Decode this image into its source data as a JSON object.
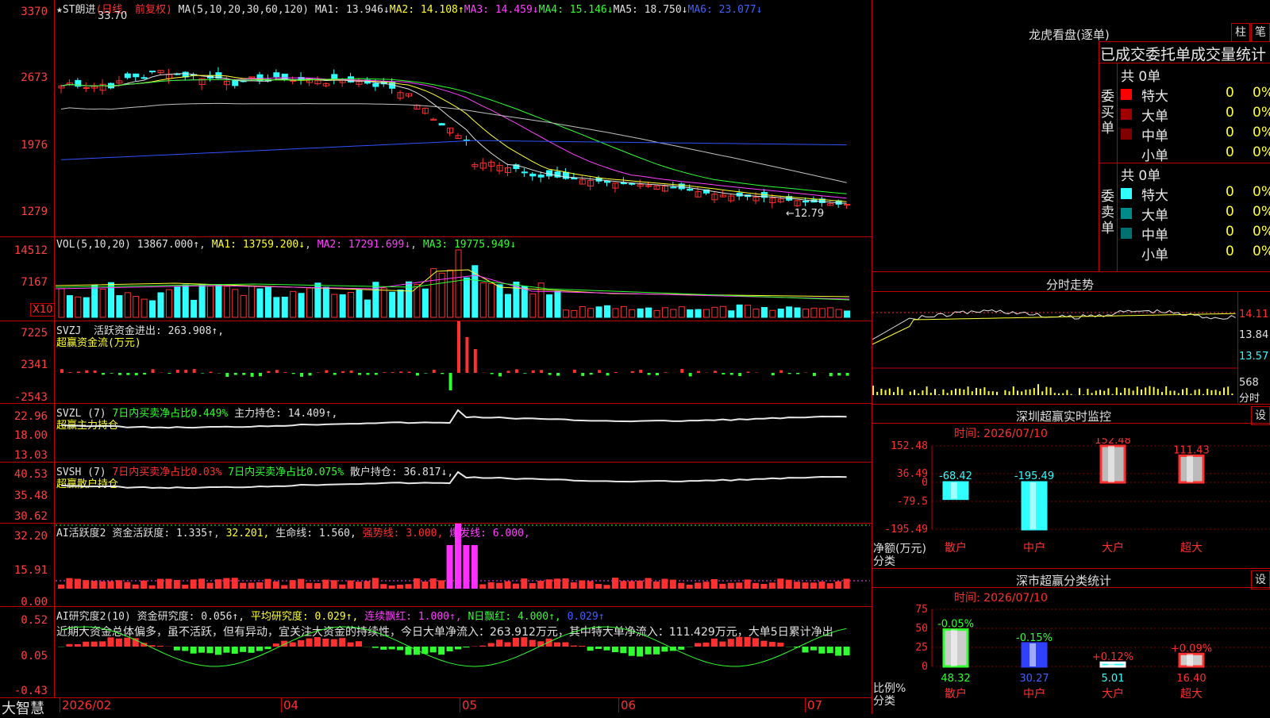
{
  "brand": "大智慧",
  "stock": {
    "title": "★ST朗进",
    "mode": "(日线, 前复权)"
  },
  "main": {
    "ma_params": "MA(5,10,20,30,60,120)",
    "ma": [
      {
        "name": "MA1",
        "value": "13.946↓",
        "color": "#e0e0e0"
      },
      {
        "name": "MA2",
        "value": "14.108↑",
        "color": "#ffff30"
      },
      {
        "name": "MA3",
        "value": "14.459↓",
        "color": "#ff40ff"
      },
      {
        "name": "MA4",
        "value": "15.146↓",
        "color": "#30ff30"
      },
      {
        "name": "MA5",
        "value": "18.750↓",
        "color": "#d0d0d0"
      },
      {
        "name": "MA6",
        "value": "23.077↓",
        "color": "#3050ff"
      }
    ],
    "yticks": [
      "3370",
      "2673",
      "1976",
      "1279"
    ],
    "high_label": "33.70",
    "low_label": "←12.79"
  },
  "vol": {
    "title": "VOL(5,10,20)",
    "value": "13867.000↑",
    "ma1": "MA1: 13759.200↓",
    "ma2": "MA2: 17291.699↓",
    "ma3": "MA3: 19775.949↓",
    "yticks": [
      "14512",
      "7167"
    ],
    "unit": "X10"
  },
  "svzj": {
    "title": "SVZJ",
    "text": "活跃资金进出: 263.908↑,",
    "sub": "超赢资金流(万元)",
    "yticks": [
      "7225",
      "2341",
      "-2543"
    ]
  },
  "svzl": {
    "title": "SVZL (7)",
    "t1": "7日内买卖净占比0.449%",
    "t2": "主力持仓: 14.409↑,",
    "sub": "超赢主力持仓",
    "yticks": [
      "22.96",
      "18.00",
      "13.03"
    ]
  },
  "svsh": {
    "title": "SVSH (7)",
    "t1": "7日内买卖净占比0.03%",
    "t2": "7日内买卖净占比0.075%",
    "t3": "散户持仓: 36.817↓,",
    "sub": "超赢散户持仓",
    "yticks": [
      "40.53",
      "35.48",
      "30.62"
    ]
  },
  "ai1": {
    "title": "AI活跃度2",
    "t1": "资金活跃度: 1.335↑",
    "t2": "32.201,",
    "t3": "生命线: 1.560,",
    "t4": "强势线: 3.000,",
    "t5": "爆发线: 6.000,",
    "yticks": [
      "32.20",
      "15.91",
      "0.00"
    ]
  },
  "ai2": {
    "title": "AI研究度2(10)",
    "t1": "资金研究度: 0.056↑,",
    "t2": "平均研究度: 0.029↑,",
    "t3": "连续飘红: 1.000↑,",
    "t4": "N日飘红: 4.000↑,",
    "t5": "0.029↑",
    "comment": "近期大资金总体偏多，虽不活跃，但有异动，宜关注大资金的持续性，今日大单净流入：263.912万元，其中特大单净流入：111.429万元，大单5日累计净出",
    "yticks": [
      "0.52",
      "0.05",
      "-0.43"
    ]
  },
  "xaxis": [
    "2026/02",
    "04",
    "05",
    "06",
    "07"
  ],
  "lhb": {
    "title": "龙虎看盘(逐单)",
    "btn1": "柱",
    "btn2": "笔",
    "header": "已成交委托单成交量统计",
    "buy": {
      "label": "委买单",
      "total": "共 0单",
      "rows": [
        {
          "name": "特大",
          "v": "0",
          "p": "0%"
        },
        {
          "name": "大单",
          "v": "0",
          "p": "0%"
        },
        {
          "name": "中单",
          "v": "0",
          "p": "0%"
        },
        {
          "name": "小单",
          "v": "0",
          "p": "0%"
        }
      ]
    },
    "sell": {
      "label": "委卖单",
      "total": "共 0单",
      "rows": [
        {
          "name": "特大",
          "v": "0",
          "p": "0%"
        },
        {
          "name": "大单",
          "v": "0",
          "p": "0%"
        },
        {
          "name": "中单",
          "v": "0",
          "p": "0%"
        },
        {
          "name": "小单",
          "v": "0",
          "p": "0%"
        }
      ]
    }
  },
  "fs": {
    "title": "分时走势",
    "yticks": [
      "14.11",
      "13.84",
      "13.57"
    ],
    "vol": "568",
    "vol_unit": "分时"
  },
  "sz_monitor": {
    "title": "深圳超赢实时监控",
    "btn": "设",
    "time": "时间: 2026/07/10",
    "ylabel1": "净额(万元)",
    "ylabel2": "分类"
  },
  "sz_stat": {
    "title": "深市超赢分类统计",
    "btn": "设",
    "time": "时间: 2026/07/10",
    "ylabel1": "比例%",
    "ylabel2": "分类"
  },
  "chart_data": [
    {
      "type": "bar",
      "title": "深圳超赢实时监控",
      "categories": [
        "散户",
        "中户",
        "大户",
        "超大"
      ],
      "values": [
        -68.42,
        -195.49,
        152.48,
        111.43
      ],
      "ylabel": "净额(万元)",
      "yticks": [
        152.48,
        36.49,
        0,
        -79.5,
        -195.49
      ],
      "ylim": [
        -195.49,
        152.48
      ]
    },
    {
      "type": "bar",
      "title": "深市超赢分类统计",
      "categories": [
        "散户",
        "中户",
        "大户",
        "超大"
      ],
      "values": [
        48.32,
        30.27,
        5.01,
        16.4
      ],
      "changes": [
        "-0.05%",
        "-0.15%",
        "+0.12%",
        "+0.09%"
      ],
      "ylabel": "比例%",
      "yticks": [
        75,
        50,
        25,
        0
      ],
      "ylim": [
        0,
        75
      ]
    },
    {
      "type": "line",
      "title": "分时走势",
      "ylim": [
        13.5,
        14.2
      ],
      "yticks": [
        14.11,
        13.84,
        13.57
      ]
    }
  ]
}
